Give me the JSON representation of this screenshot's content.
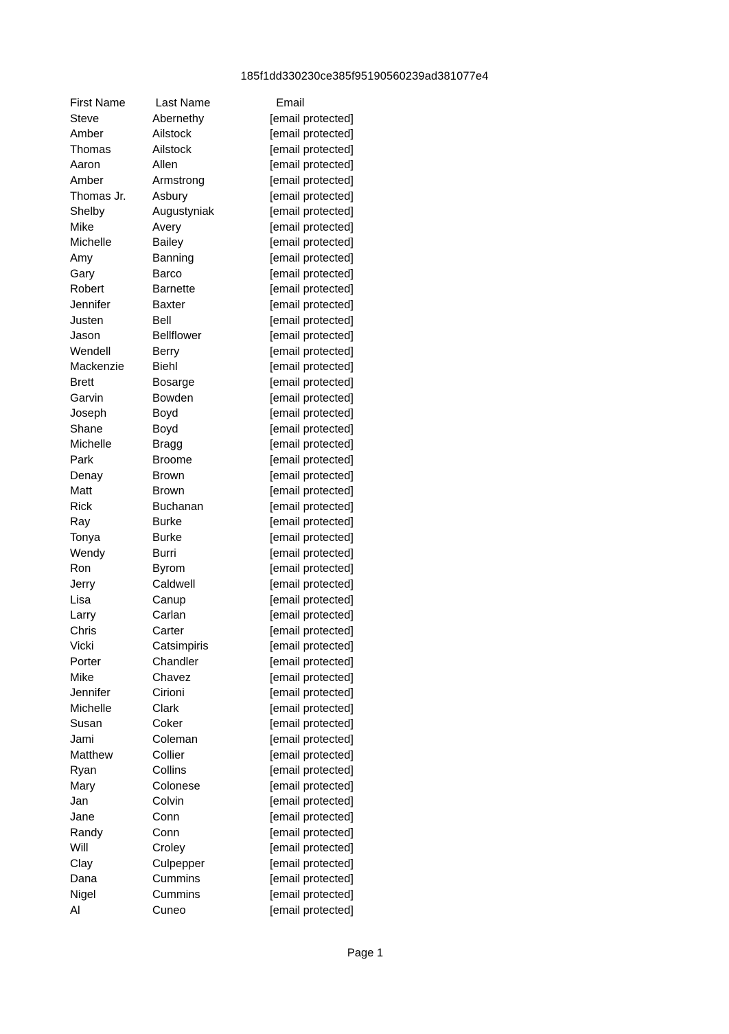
{
  "document": {
    "title": "185f1dd330230ce385f95190560239ad381077e4",
    "footer": "Page 1"
  },
  "table": {
    "columns": [
      "First Name",
      "Last Name",
      "Email"
    ],
    "rows": [
      [
        "Steve",
        "Abernethy",
        "[email protected]"
      ],
      [
        "Amber",
        "Ailstock",
        "[email protected]"
      ],
      [
        "Thomas",
        "Ailstock",
        "[email protected]"
      ],
      [
        "Aaron",
        "Allen",
        "[email protected]"
      ],
      [
        "Amber",
        "Armstrong",
        "[email protected]"
      ],
      [
        "Thomas Jr.",
        "Asbury",
        "[email protected]"
      ],
      [
        "Shelby",
        "Augustyniak",
        "[email protected]"
      ],
      [
        "Mike",
        "Avery",
        "[email protected]"
      ],
      [
        "Michelle",
        "Bailey",
        "[email protected]"
      ],
      [
        "Amy",
        "Banning",
        "[email protected]"
      ],
      [
        "Gary",
        "Barco",
        "[email protected]"
      ],
      [
        "Robert",
        "Barnette",
        "[email protected]"
      ],
      [
        "Jennifer",
        "Baxter",
        "[email protected]"
      ],
      [
        "Justen",
        "Bell",
        "[email protected]"
      ],
      [
        "Jason",
        "Bellflower",
        "[email protected]"
      ],
      [
        "Wendell",
        "Berry",
        "[email protected]"
      ],
      [
        "Mackenzie",
        "Biehl",
        "[email protected]"
      ],
      [
        "Brett",
        "Bosarge",
        "[email protected]"
      ],
      [
        "Garvin",
        "Bowden",
        "[email protected]"
      ],
      [
        "Joseph",
        "Boyd",
        "[email protected]"
      ],
      [
        "Shane",
        "Boyd",
        "[email protected]"
      ],
      [
        "Michelle",
        "Bragg",
        "[email protected]"
      ],
      [
        "Park",
        "Broome",
        "[email protected]"
      ],
      [
        "Denay",
        "Brown",
        "[email protected]"
      ],
      [
        "Matt",
        "Brown",
        "[email protected]"
      ],
      [
        "Rick",
        "Buchanan",
        "[email protected]"
      ],
      [
        "Ray",
        "Burke",
        "[email protected]"
      ],
      [
        "Tonya",
        "Burke",
        "[email protected]"
      ],
      [
        "Wendy",
        "Burri",
        "[email protected]"
      ],
      [
        "Ron",
        "Byrom",
        "[email protected]"
      ],
      [
        "Jerry",
        "Caldwell",
        "[email protected]"
      ],
      [
        "Lisa",
        "Canup",
        "[email protected]"
      ],
      [
        "Larry",
        "Carlan",
        "[email protected]"
      ],
      [
        "Chris",
        "Carter",
        "[email protected]"
      ],
      [
        "Vicki",
        "Catsimpiris",
        "[email protected]"
      ],
      [
        "Porter",
        "Chandler",
        "[email protected]"
      ],
      [
        "Mike",
        "Chavez",
        "[email protected]"
      ],
      [
        "Jennifer",
        "Cirioni",
        "[email protected]"
      ],
      [
        "Michelle",
        "Clark",
        "[email protected]"
      ],
      [
        "Susan",
        "Coker",
        "[email protected]"
      ],
      [
        "Jami",
        "Coleman",
        "[email protected]"
      ],
      [
        "Matthew",
        "Collier",
        "[email protected]"
      ],
      [
        "Ryan",
        "Collins",
        "[email protected]"
      ],
      [
        "Mary",
        "Colonese",
        "[email protected]"
      ],
      [
        "Jan",
        "Colvin",
        "[email protected]"
      ],
      [
        "Jane",
        "Conn",
        "[email protected]"
      ],
      [
        "Randy",
        "Conn",
        "[email protected]"
      ],
      [
        "Will",
        "Croley",
        "[email protected]"
      ],
      [
        "Clay",
        "Culpepper",
        "[email protected]"
      ],
      [
        "Dana",
        "Cummins",
        "[email protected]"
      ],
      [
        "Nigel",
        "Cummins",
        "[email protected]"
      ],
      [
        "Al",
        "Cuneo",
        "[email protected]"
      ]
    ]
  }
}
